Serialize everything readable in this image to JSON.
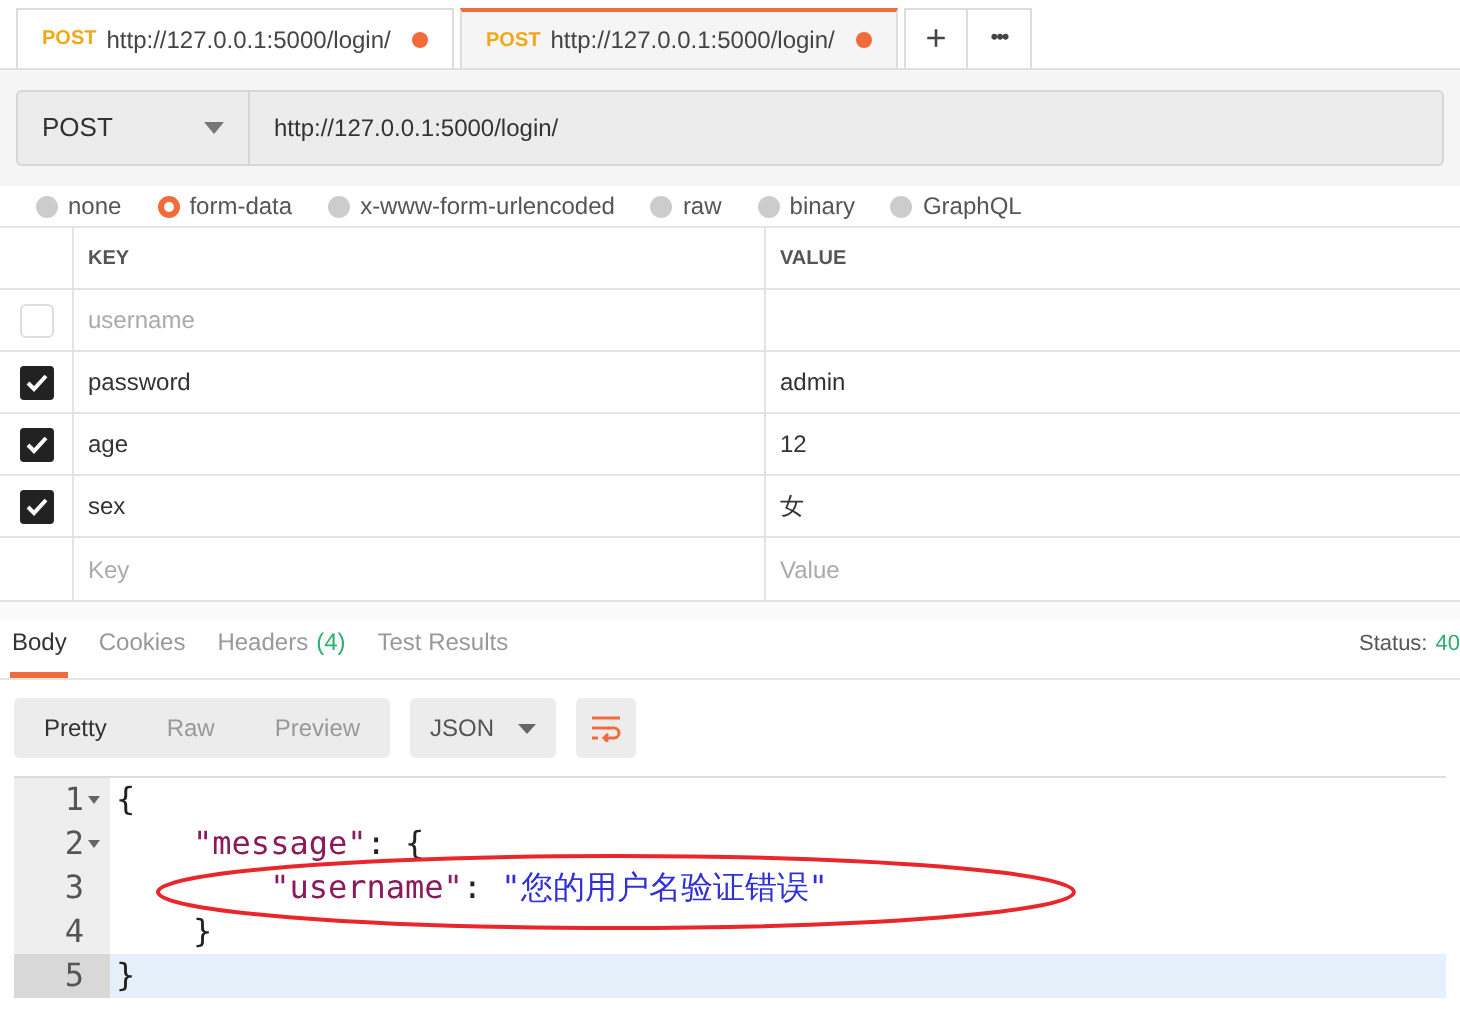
{
  "tabs": [
    {
      "method": "POST",
      "url": "http://127.0.0.1:5000/login/",
      "selected": false,
      "unsaved": true
    },
    {
      "method": "POST",
      "url": "http://127.0.0.1:5000/login/",
      "selected": true,
      "unsaved": true
    }
  ],
  "tab_actions": [
    "+",
    "•••"
  ],
  "request": {
    "method": "POST",
    "url": "http://127.0.0.1:5000/login/"
  },
  "body_types": [
    {
      "label": "none",
      "selected": false
    },
    {
      "label": "form-data",
      "selected": true
    },
    {
      "label": "x-www-form-urlencoded",
      "selected": false
    },
    {
      "label": "raw",
      "selected": false
    },
    {
      "label": "binary",
      "selected": false
    },
    {
      "label": "GraphQL",
      "selected": false
    }
  ],
  "params": {
    "columns": [
      "KEY",
      "VALUE"
    ],
    "rows": [
      {
        "key": "username",
        "value": "",
        "checked": false
      },
      {
        "key": "password",
        "value": "admin",
        "checked": true
      },
      {
        "key": "age",
        "value": "12",
        "checked": true
      },
      {
        "key": "sex",
        "value": "女",
        "checked": true
      }
    ],
    "new_row": {
      "key_placeholder": "Key",
      "value_placeholder": "Value"
    }
  },
  "response_tabs": [
    {
      "label": "Body",
      "selected": true
    },
    {
      "label": "Cookies",
      "selected": false
    },
    {
      "label": "Headers",
      "count": "(4)",
      "selected": false
    },
    {
      "label": "Test Results",
      "selected": false
    }
  ],
  "status": {
    "label": "Status:",
    "value": "40"
  },
  "view_modes": [
    {
      "label": "Pretty",
      "selected": true
    },
    {
      "label": "Raw",
      "selected": false
    },
    {
      "label": "Preview",
      "selected": false
    }
  ],
  "format": "JSON",
  "code_lines": [
    {
      "number": "1",
      "foldable": true,
      "selected": false,
      "tokens": [
        {
          "kind": "punct",
          "text": "{"
        }
      ]
    },
    {
      "number": "2",
      "foldable": true,
      "selected": false,
      "tokens": [
        {
          "kind": "key",
          "text": "    \"message\""
        },
        {
          "kind": "punct",
          "text": ": {"
        }
      ]
    },
    {
      "number": "3",
      "foldable": false,
      "selected": false,
      "tokens": [
        {
          "kind": "key",
          "text": "        \"username\""
        },
        {
          "kind": "punct",
          "text": ": "
        },
        {
          "kind": "string",
          "text": "\"您的用户名验证错误\""
        }
      ]
    },
    {
      "number": "4",
      "foldable": false,
      "selected": false,
      "tokens": [
        {
          "kind": "punct",
          "text": "    }"
        }
      ]
    },
    {
      "number": "5",
      "foldable": false,
      "selected": true,
      "tokens": [
        {
          "kind": "punct",
          "text": "}"
        }
      ]
    }
  ]
}
